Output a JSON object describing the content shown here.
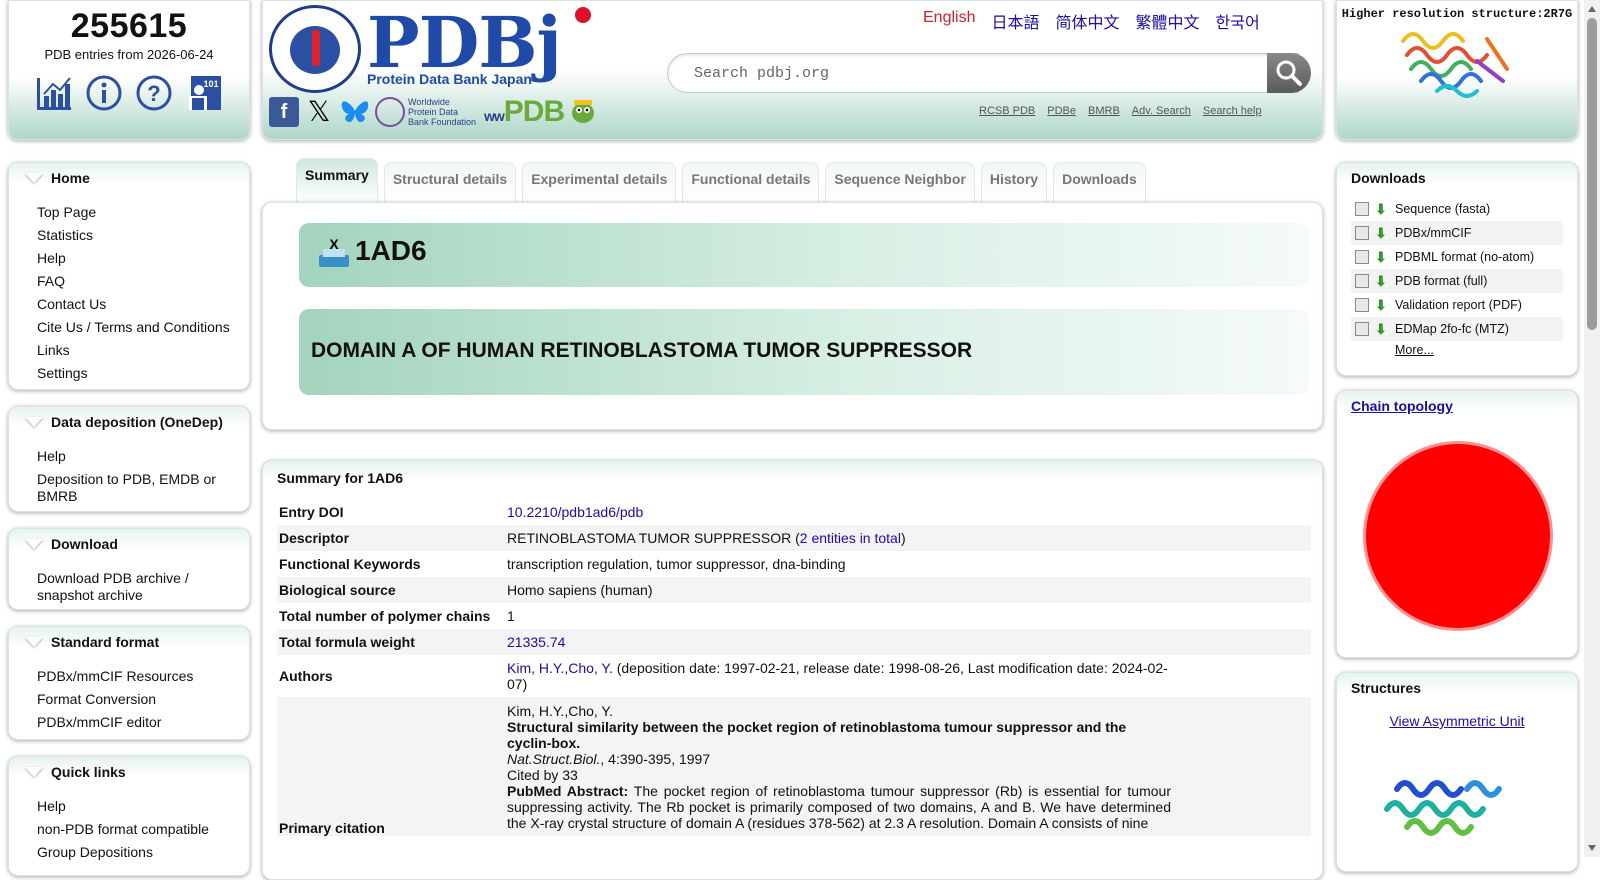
{
  "stats": {
    "count": "255615",
    "subtitle": "PDB entries from 2026-06-24"
  },
  "header": {
    "logo_text": "PDBj",
    "logo_sub": "Protein Data Bank Japan",
    "wpf_text": "Worldwide Protein Data Bank Foundation",
    "wwpdb_text": "PDB",
    "languages": [
      {
        "label": "English",
        "active": true
      },
      {
        "label": "日本語"
      },
      {
        "label": "简体中文"
      },
      {
        "label": "繁體中文"
      },
      {
        "label": "한국어"
      }
    ],
    "search_placeholder": "Search pdbj.org",
    "links": [
      "RCSB PDB",
      "PDBe",
      "BMRB",
      "Adv. Search",
      "Search help"
    ]
  },
  "hires": {
    "caption": "Higher resolution structure:2R7G"
  },
  "sidebar": {
    "home": {
      "title": "Home",
      "items": [
        "Top Page",
        "Statistics",
        "Help",
        "FAQ",
        "Contact Us",
        "Cite Us / Terms and Conditions",
        "Links",
        "Settings"
      ]
    },
    "deposition": {
      "title": "Data deposition (OneDep)",
      "items": [
        "Help",
        "Deposition to PDB, EMDB or BMRB"
      ]
    },
    "download": {
      "title": "Download",
      "items": [
        "Download PDB archive / snapshot archive"
      ]
    },
    "standard": {
      "title": "Standard format",
      "items": [
        "PDBx/mmCIF Resources",
        "Format Conversion",
        "PDBx/mmCIF editor"
      ]
    },
    "quick": {
      "title": "Quick links",
      "items": [
        "Help",
        "non-PDB format compatible",
        "Group Depositions"
      ]
    }
  },
  "tabs": [
    "Summary",
    "Structural details",
    "Experimental details",
    "Functional details",
    "Sequence Neighbor",
    "History",
    "Downloads"
  ],
  "entry": {
    "id": "1AD6",
    "name": "DOMAIN A OF HUMAN RETINOBLASTOMA TUMOR SUPPRESSOR"
  },
  "summary": {
    "title": "Summary for 1AD6",
    "rows": {
      "doi": {
        "k": "Entry DOI",
        "v": "10.2210/pdb1ad6/pdb"
      },
      "descriptor": {
        "k": "Descriptor",
        "v": "RETINOBLASTOMA TUMOR SUPPRESSOR (",
        "link": "2 entities in total",
        "tail": ")"
      },
      "keywords": {
        "k": "Functional Keywords",
        "v": "transcription regulation, tumor suppressor, dna-binding"
      },
      "source": {
        "k": "Biological source",
        "v": "Homo sapiens (human)"
      },
      "chains": {
        "k": "Total number of polymer chains",
        "v": "1"
      },
      "weight": {
        "k": "Total formula weight",
        "v": "21335.74"
      },
      "authors": {
        "k": "Authors",
        "link": "Kim, H.Y.,Cho, Y.",
        "v": " (deposition date: 1997-02-21, release date: 1998-08-26, Last modification date: 2024-02-07)"
      },
      "citation": {
        "k": "Primary citation",
        "authors": "Kim, H.Y.,Cho, Y.",
        "title": "Structural similarity between the pocket region of retinoblastoma tumour suppressor and the cyclin-box.",
        "journal": "Nat.Struct.Biol.",
        "journal_tail": ", 4:390-395, 1997",
        "cited": "Cited by 33",
        "abstract_label": "PubMed Abstract:",
        "abstract": " The pocket region of retinoblastoma tumour suppressor (Rb) is essential for tumour suppressing activity. The Rb pocket is primarily composed of two domains, A and B. We have determined the X-ray crystal structure of domain A (residues 378-562) at 2.3 A resolution. Domain A consists of nine"
      }
    }
  },
  "downloads": {
    "title": "Downloads",
    "items": [
      "Sequence (fasta)",
      "PDBx/mmCIF",
      "PDBML format (no-atom)",
      "PDB format (full)",
      "Validation report (PDF)",
      "EDMap 2fo-fc (MTZ)"
    ],
    "more": "More..."
  },
  "topology": {
    "title": "Chain topology",
    "color": "#ff0000"
  },
  "structures": {
    "title": "Structures",
    "link": "View Asymmetric Unit"
  }
}
